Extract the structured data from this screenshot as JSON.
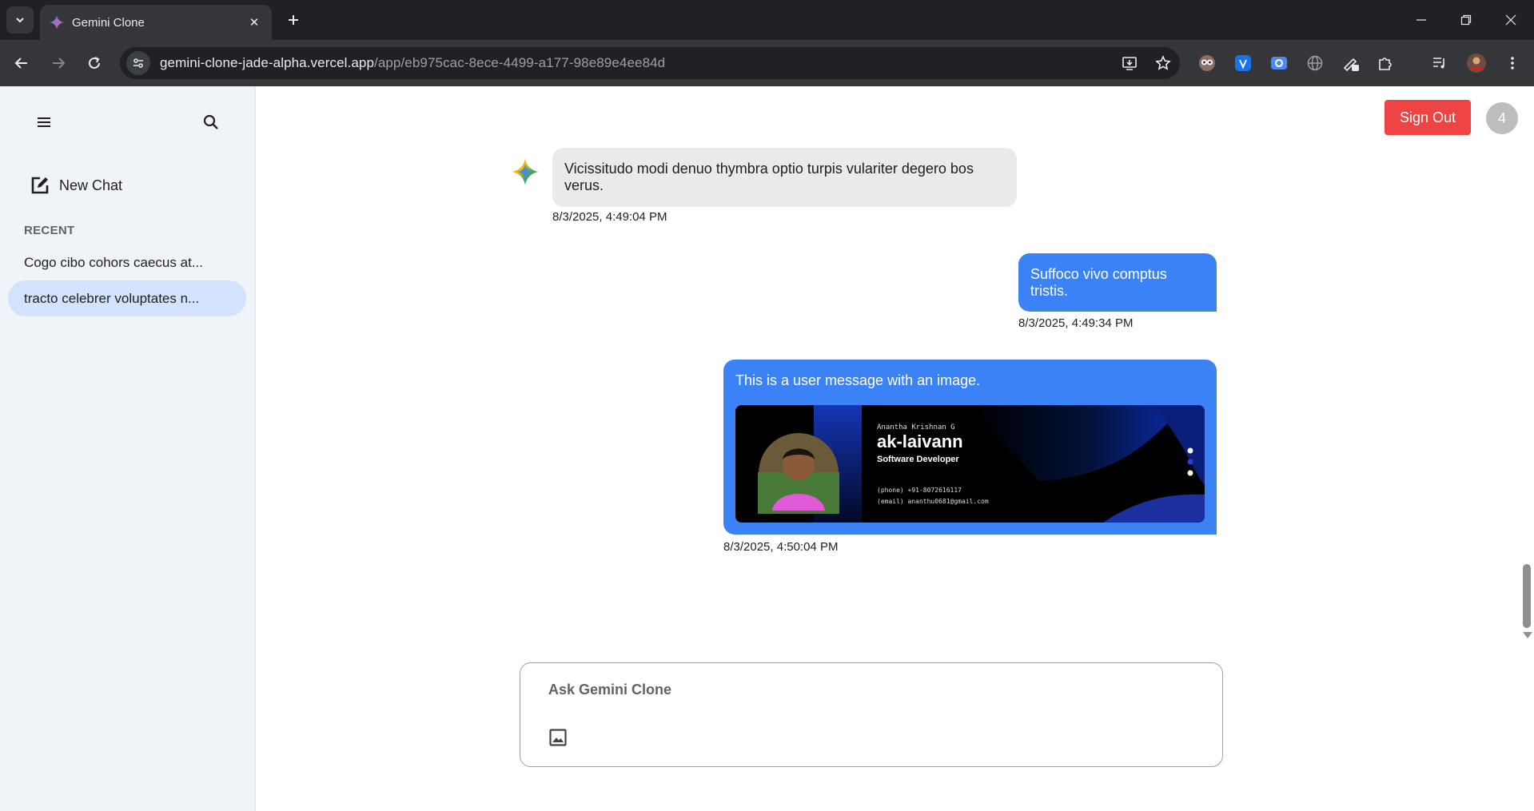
{
  "browser": {
    "tab_title": "Gemini Clone",
    "tab_close": "✕",
    "new_tab": "+",
    "url_domain": "gemini-clone-jade-alpha.vercel.app",
    "url_path": "/app/eb975cac-8ece-4499-a177-98e89e4ee84d"
  },
  "sidebar": {
    "new_chat_label": "New Chat",
    "recent_label": "RECENT",
    "recent_items": [
      {
        "label": "Cogo cibo cohors caecus at..."
      },
      {
        "label": "tracto celebrer voluptates n..."
      }
    ]
  },
  "header": {
    "sign_out_label": "Sign Out",
    "avatar_initial": "4"
  },
  "messages": [
    {
      "role": "ai",
      "text": "Vicissitudo modi denuo thymbra optio turpis vulariter degero bos verus.",
      "timestamp": "8/3/2025, 4:49:04 PM"
    },
    {
      "role": "user",
      "text": "Suffoco vivo comptus tristis.",
      "timestamp": "8/3/2025, 4:49:34 PM"
    },
    {
      "role": "user",
      "text": "This is a user message with an image.",
      "timestamp": "8/3/2025, 4:50:04 PM",
      "image": {
        "name_small": "Anantha Krishnan G",
        "name": "ak-laivann",
        "role": "Software Developer",
        "phone": "(phone) +91-8072616117",
        "email": "(email) ananthu0681@gmail.com"
      }
    }
  ],
  "composer": {
    "placeholder": "Ask Gemini Clone"
  },
  "colors": {
    "user_bubble": "#3b82f6",
    "ai_bubble": "#e9eaec",
    "sign_out": "#ef4444",
    "sidebar_bg": "#f0f4f9",
    "active_item": "#d3e3fd"
  }
}
